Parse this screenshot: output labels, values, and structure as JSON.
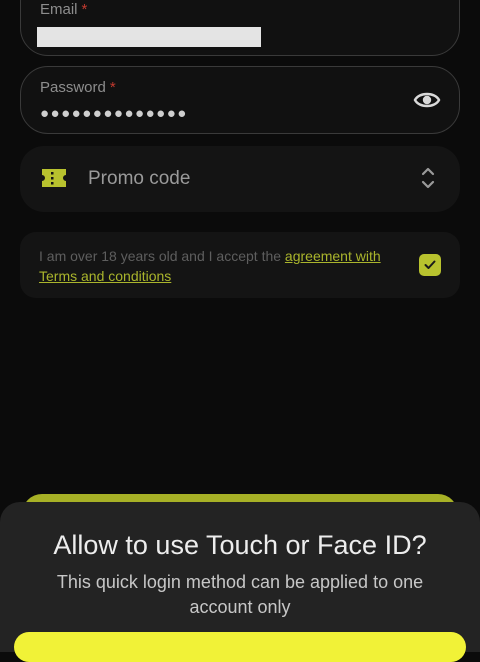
{
  "email": {
    "label": "Email",
    "required_mark": "*"
  },
  "password": {
    "label": "Password",
    "required_mark": "*",
    "value_masked": "●●●●●●●●●●●●●●"
  },
  "promo": {
    "label": "Promo code"
  },
  "agreement": {
    "text": "I am over 18 years old and I accept the ",
    "link": "agreement with Terms and conditions",
    "checked": true
  },
  "sheet": {
    "title": "Allow to use Touch or Face ID?",
    "subtitle": "This quick login method can be applied to one account only"
  },
  "colors": {
    "accent": "#b8c22e",
    "button": "#f1f237",
    "required": "#c23a2f"
  },
  "icons": [
    "eye-icon",
    "ticket-icon",
    "chevron-updown-icon",
    "checkmark-icon"
  ]
}
